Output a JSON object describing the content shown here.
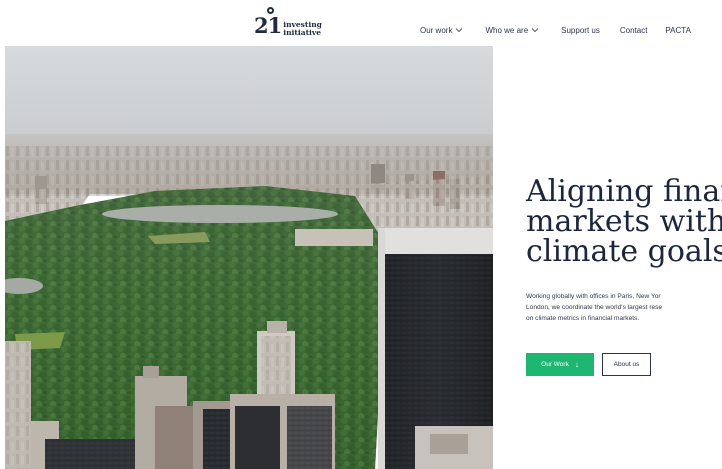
{
  "header": {
    "logo": {
      "mark": "2",
      "mark_sub": "1",
      "line1": "investing",
      "line2": "initiative"
    },
    "nav": [
      {
        "label": "Our work",
        "has_dropdown": true
      },
      {
        "label": "Who we are",
        "has_dropdown": true
      },
      {
        "label": "Support us",
        "has_dropdown": false
      },
      {
        "label": "Contact",
        "has_dropdown": false
      },
      {
        "label": "PACTA",
        "has_dropdown": false
      }
    ]
  },
  "hero": {
    "headline": [
      "Aligning financ",
      "markets with",
      "climate goals"
    ],
    "subtext": [
      "Working globally with offices in Paris, New Yor",
      "London, we coordinate the world's largest rese",
      "on climate metrics in financial markets."
    ],
    "primary_button": {
      "label": "Our Work",
      "icon": "arrow-down-icon"
    },
    "secondary_button": {
      "label": "About us"
    }
  },
  "colors": {
    "brand_navy": "#1f2a44",
    "accent_green": "#1eb771",
    "text_dark": "#1c2640"
  }
}
